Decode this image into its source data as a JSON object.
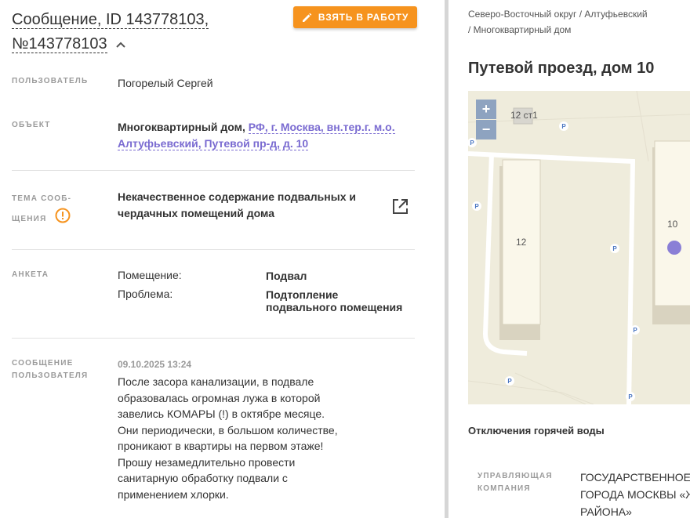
{
  "header": {
    "title_line1": "Сообщение, ID 143778103,",
    "title_line2": "№143778103",
    "take_button": "ВЗЯТЬ В РАБОТУ"
  },
  "fields": {
    "user_label": "ПОЛЬЗОВАТЕЛЬ",
    "user_value": "Погорелый Сергей",
    "object_label": "ОБЪЕКТ",
    "object_type": "Многоквартирный дом,",
    "object_address_line1": "РФ, г. Москва, вн.тер.г. м.о.",
    "object_address_line2": "Алтуфьевский, Путевой пр-д, д. 10",
    "topic_label_line1": "ТЕМА СООБ-",
    "topic_label_line2": "ЩЕНИЯ",
    "topic_value_line1": "Некачественное содержание подвальных и",
    "topic_value_line2": "чердачных помещений дома",
    "survey_label": "АНКЕТА",
    "survey_room_key": "Помещение:",
    "survey_room_value": "Подвал",
    "survey_problem_key": "Проблема:",
    "survey_problem_value": "Подтопление подвального помещения",
    "message_label_line1": "СООБЩЕНИЕ",
    "message_label_line2": "ПОЛЬЗОВАТЕЛЯ",
    "message_date": "09.10.2025 13:24",
    "message_text": "После засора канализации, в подвале образовалась огромная лужа в которой завелись КОМАРЫ (!) в октябре месяце. Они периодически, в большом количестве, проникают в квартиры на первом этаже! Прошу незамедлительно провести санитарную обработку подвали с применением хлорки."
  },
  "right": {
    "breadcrumb_line1": "Северо-Восточный округ / Алтуфьевский",
    "breadcrumb_line2": "/ Многоквартирный дом",
    "address": "Путевой проезд, дом 10",
    "map": {
      "zoom_in": "+",
      "zoom_out": "−",
      "label_12st1": "12 ст1",
      "label_12": "12",
      "label_10": "10",
      "parking": "P"
    },
    "hot_water": "Отключения горячей воды",
    "mgmt_label_line1": "УПРАВЛЯЮЩАЯ",
    "mgmt_label_line2": "КОМПАНИЯ",
    "mgmt_value_line1": "ГОСУДАРСТВЕННОЕ Б",
    "mgmt_value_line2": "ГОРОДА МОСКВЫ «Ж",
    "mgmt_value_line3": "РАЙОНА»"
  },
  "colors": {
    "accent_orange": "#f6931e",
    "link_purple": "#7a6bd1",
    "map_bg": "#efecdc",
    "marker": "#8a7fd6"
  }
}
